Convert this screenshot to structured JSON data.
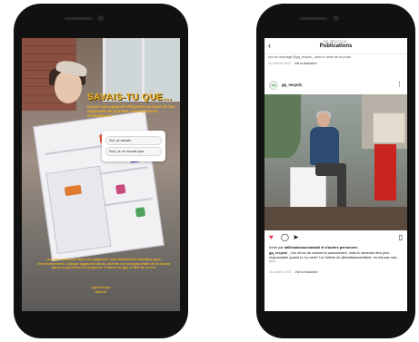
{
  "left_phone": {
    "story_title": "SAVAIS-TU QUE...",
    "story_question": "laisser son appareil réfrigérant au bord de rue augmente de grandes conséquences écologiques?",
    "poll_option_1": "Oui, je savais",
    "poll_option_2": "Non, je ne savais pas",
    "story_text": "Les gaz contenus dans ces appareils sont hautement nuisibles pour l'environnement. Chaque appareil mis au chemin ne sera pas traité de la bonne façon et génèrera en moyenne 1 tonne de gaz à effet de serre!",
    "hashtags": "#grosrecyc\n#ptrefr"
  },
  "right_phone": {
    "header_account": "GQ_RECYCLE_",
    "header_title": "Publications",
    "prev_caption": "prix du recyclage @gq_recycle_ dans le cadre de ce projet",
    "prev_date": "26 octobre 2023",
    "prev_translate": "Voir la traduction",
    "avatar_label": "GQ",
    "post_user": "gq_recycle_",
    "likes_user": "lafilleaubeauchandail",
    "likes_rest": " et d'autres personnes",
    "likes_prefix": "Aimé par ",
    "caption_user": "gq_recycle_",
    "caption_text": " Les rénos de cuisine te passionnent, mais tu aimerais être plus responsable quand tu t'y mets? Lis l'article de @leatlabandofficiel, en est pas mal...",
    "more_label": " plus",
    "post_date": "16 octobre 2023",
    "post_translate": "Voir la traduction"
  },
  "icons": {
    "back": "back-icon",
    "more": "more-icon",
    "like": "heart-icon",
    "comment": "comment-icon",
    "share": "share-icon",
    "save": "bookmark-icon"
  },
  "colors": {
    "story_accent": "#f0b322",
    "like_red": "#ed2f4a"
  }
}
